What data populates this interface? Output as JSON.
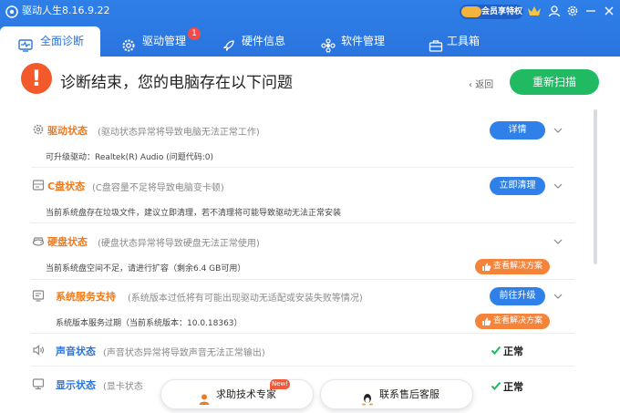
{
  "app": {
    "title": "驱动人生8.16.9.22",
    "vip_text": "会员享特权"
  },
  "tabs": [
    {
      "label": "全面诊断",
      "active": true
    },
    {
      "label": "驱动管理",
      "badge": "1"
    },
    {
      "label": "硬件信息"
    },
    {
      "label": "软件管理"
    },
    {
      "label": "工具箱"
    }
  ],
  "main": {
    "title": "诊断结束，您的电脑存在以下问题",
    "back": "返回",
    "rescan": "重新扫描"
  },
  "rows": [
    {
      "name": "驱动状态",
      "desc": "(驱动状态异常将导致电脑无法正常工作)",
      "detail": "可升级驱动：Realtek(R) Audio (问题代码:0)",
      "action": "详情"
    },
    {
      "name": "C盘状态",
      "desc": "(C盘容量不足将导致电脑变卡顿)",
      "detail": "当前系统盘存在垃圾文件，建议立即清理，若不清理将可能导致驱动无法正常安装",
      "action": "立即清理"
    },
    {
      "name": "硬盘状态",
      "desc": "(硬盘状态异常将导致硬盘无法正常使用)",
      "detail": "当前系统盘空间不足，请进行扩容（剩余6.4 GB可用）",
      "action": "查看解决方案"
    },
    {
      "name": "系统服务支持",
      "desc": "(系统版本过低将有可能出现驱动无适配或安装失败等情况)",
      "detail": "系统版本服务过期（当前系统版本：10.0.18363）",
      "action": "前往升级",
      "action2": "查看解决方案"
    },
    {
      "name": "声音状态",
      "desc": "(声音状态异常将导致声音无法正常输出)",
      "status": "正常"
    },
    {
      "name": "显示状态",
      "desc": "(显卡状态",
      "status": "正常"
    }
  ],
  "bottom": {
    "expert": "求助技术专家",
    "new_badge": "New!",
    "service": "联系售后客服"
  },
  "colors": {
    "header": "#2a74de",
    "accent_green": "#1fba62",
    "warn": "#f25a2c",
    "orange": "#f07a1e",
    "blue_btn": "#2f80e8"
  }
}
